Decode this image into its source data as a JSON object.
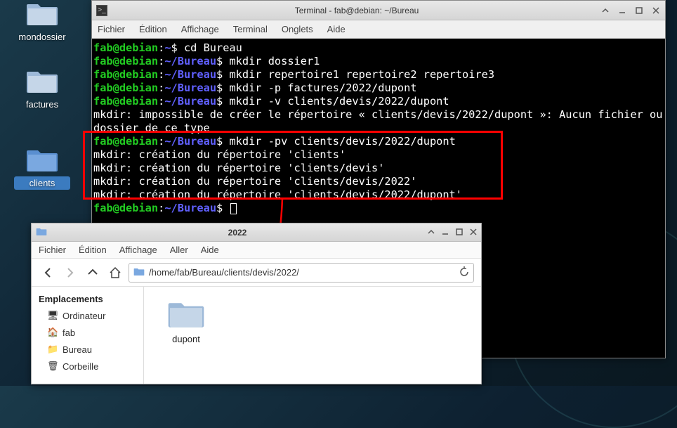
{
  "desktop": {
    "icons": [
      {
        "label": "mondossier"
      },
      {
        "label": "factures"
      },
      {
        "label": "clients"
      }
    ]
  },
  "terminal": {
    "title": "Terminal - fab@debian: ~/Bureau",
    "menu": [
      "Fichier",
      "Édition",
      "Affichage",
      "Terminal",
      "Onglets",
      "Aide"
    ],
    "prompt": {
      "user_host": "fab@debian",
      "sep1": ":",
      "tilde": "~",
      "dollar": "$ ",
      "slash": "/",
      "dir": "Bureau"
    },
    "lines": {
      "cmd0": "cd Bureau",
      "cmd1": "mkdir dossier1",
      "cmd2": "mkdir repertoire1 repertoire2 repertoire3",
      "cmd3": "mkdir -p factures/2022/dupont",
      "cmd4": "mkdir -v clients/devis/2022/dupont",
      "err": "mkdir: impossible de créer le répertoire « clients/devis/2022/dupont »: Aucun fichier ou dossier de ce type",
      "cmd5": "mkdir -pv clients/devis/2022/dupont",
      "out1": "mkdir: création du répertoire 'clients'",
      "out2": "mkdir: création du répertoire 'clients/devis'",
      "out3": "mkdir: création du répertoire 'clients/devis/2022'",
      "out4": "mkdir: création du répertoire 'clients/devis/2022/dupont'"
    }
  },
  "filemanager": {
    "title": "2022",
    "menu": [
      "Fichier",
      "Édition",
      "Affichage",
      "Aller",
      "Aide"
    ],
    "path": "/home/fab/Bureau/clients/devis/2022/",
    "places_header": "Emplacements",
    "places": [
      {
        "icon": "🖥",
        "label": "Ordinateur"
      },
      {
        "icon": "🏠",
        "label": "fab"
      },
      {
        "icon": "📁",
        "label": "Bureau"
      },
      {
        "icon": "🗑",
        "label": "Corbeille"
      }
    ],
    "item": {
      "label": "dupont"
    }
  }
}
